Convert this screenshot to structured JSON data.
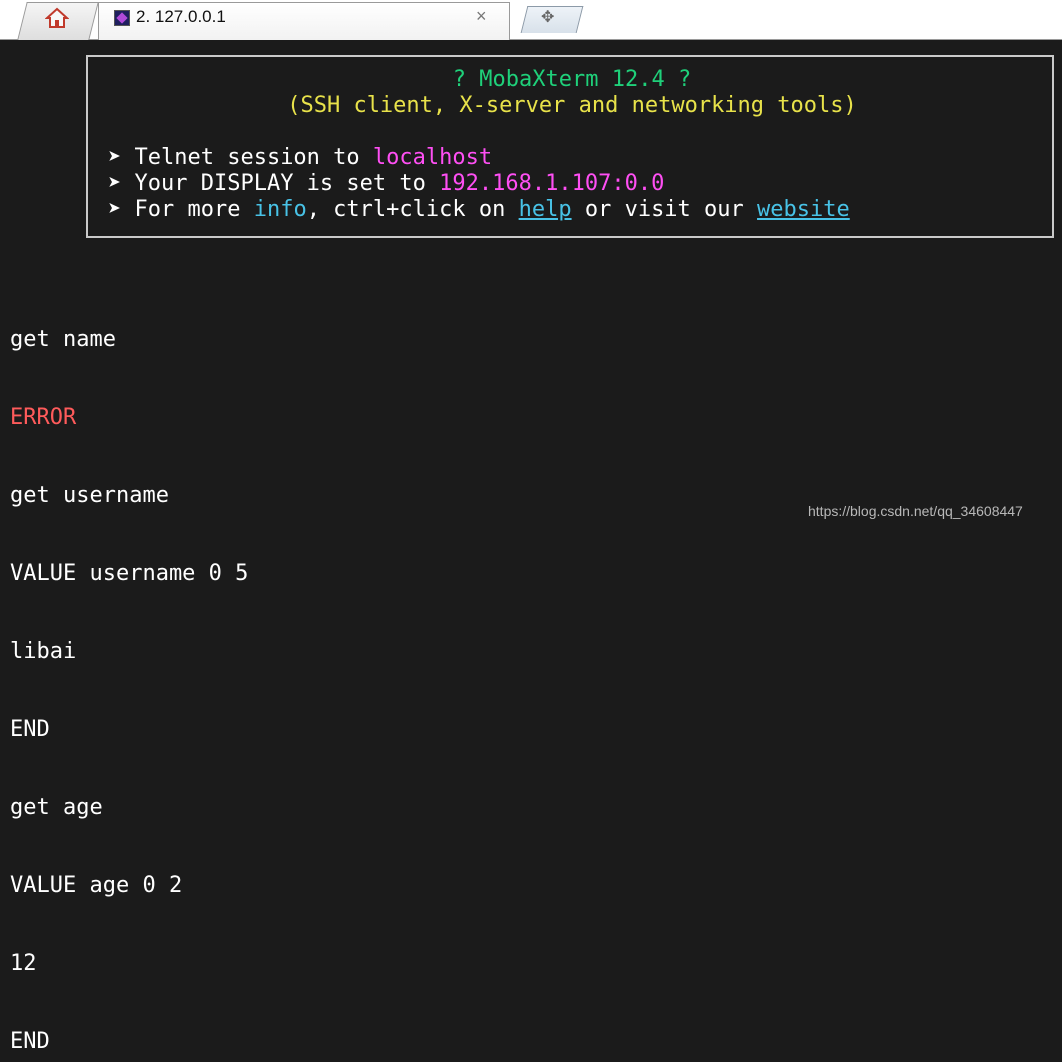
{
  "tabbar": {
    "session_tab_label": "2. 127.0.0.1",
    "close_glyph": "×",
    "new_tab_glyph": "✥"
  },
  "banner": {
    "title": "? MobaXterm 12.4 ?",
    "subtitle": "(SSH client, X-server and networking tools)",
    "bullet": "➤",
    "line1_prefix": " Telnet session to ",
    "line1_host": "localhost",
    "line2_prefix": " Your DISPLAY is set to ",
    "line2_display": "192.168.1.107:0.0",
    "line3_prefix": " For more ",
    "line3_info": "info",
    "line3_mid": ", ctrl+click on ",
    "line3_help": "help",
    "line3_mid2": " or visit our ",
    "line3_website": "website"
  },
  "terminal": {
    "lines": [
      "get name",
      "ERROR",
      "get username",
      "VALUE username 0 5",
      "libai",
      "END",
      "get age",
      "VALUE age 0 2",
      "12",
      "END"
    ]
  },
  "watermark": "https://blog.csdn.net/qq_34608447",
  "colors": {
    "background": "#1b1b1b",
    "green": "#1fd07a",
    "yellow": "#e8e24a",
    "magenta": "#ff4ff4",
    "cyan": "#48c2e6",
    "error_red": "#ff5b5b"
  },
  "icons": [
    "home-icon",
    "session-icon",
    "close-icon",
    "new-tab-icon"
  ]
}
